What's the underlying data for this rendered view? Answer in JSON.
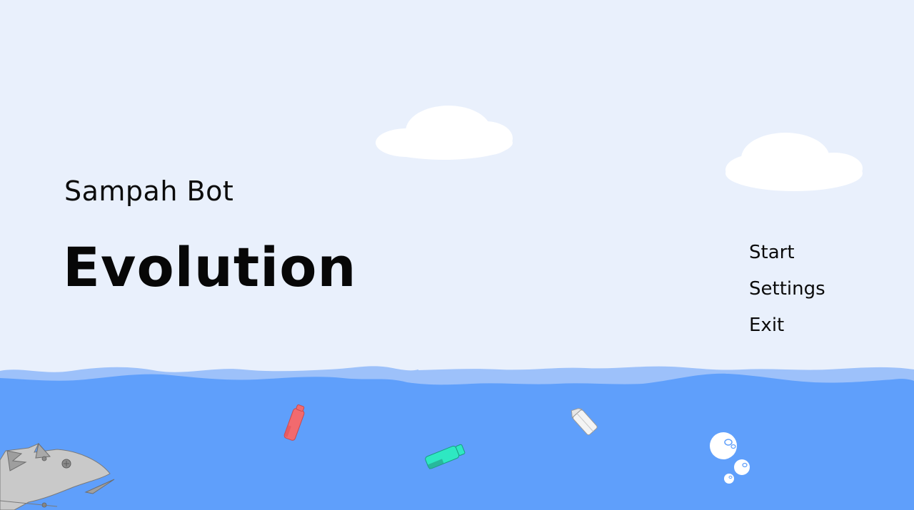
{
  "game": {
    "subtitle": "Sampah Bot",
    "title": "Evolution"
  },
  "menu": {
    "start_label": "Start",
    "settings_label": "Settings",
    "exit_label": "Exit"
  },
  "colors": {
    "sky": "#e9f0fc",
    "cloud": "#ffffff",
    "wave_light": "#9dc1fa",
    "water": "#5f9ffb",
    "text": "#0b0b0b"
  }
}
